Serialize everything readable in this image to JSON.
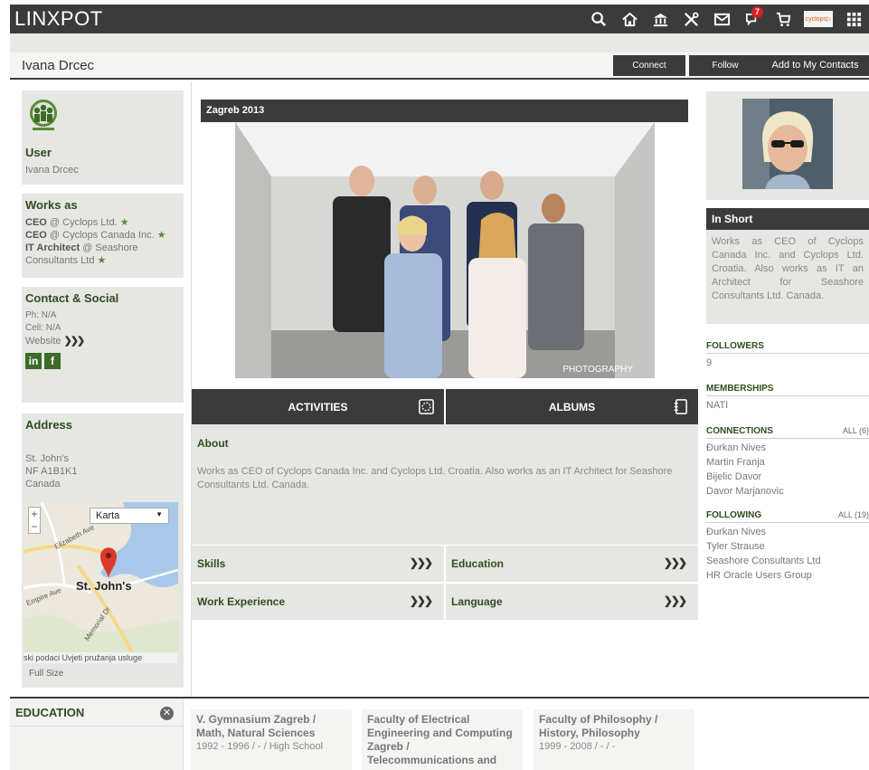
{
  "app": {
    "logo": "LINXPOT",
    "notification_count": "7",
    "cyclops_chip": "cyclops▷"
  },
  "profile": {
    "name": "Ivana Drcec",
    "connect_label": "Connect",
    "follow_label": "Follow",
    "add_contacts_label": "Add to My Contacts"
  },
  "left": {
    "user_heading": "User",
    "user_name": "Ivana Drcec",
    "works_heading": "Works as",
    "jobs": [
      {
        "role": "CEO",
        "at": "@ Cyclops Ltd."
      },
      {
        "role": "CEO",
        "at": "@ Cyclops Canada Inc."
      },
      {
        "role": "IT Architect",
        "at": "@ Seashore Consultants Ltd"
      }
    ],
    "contact_heading": "Contact & Social",
    "phone": "Ph: N/A",
    "cell": "Cell: N/A",
    "website": "Website",
    "website_arrows": "❯❯❯",
    "linkedin": "in",
    "facebook": "f",
    "address_heading": "Address",
    "address_lines": [
      "St. John's",
      "NF A1B1K1",
      "Canada"
    ],
    "map": {
      "type_select": "Karta",
      "city_label": "St. John's",
      "street1": "Elizabeth Ave",
      "street2": "Empire Ave",
      "street3": "Memorial Dr",
      "caption": "ski podaci  Uvjeti pružanja usluge",
      "full_size": "Full Size"
    }
  },
  "center": {
    "photo_title": "Zagreb 2013",
    "photo_watermark": "PHOTOGRAPHY",
    "tab_activities": "ACTIVITIES",
    "tab_albums": "ALBUMS",
    "about_heading": "About",
    "about_text": "Works as CEO of Cyclops Canada Inc. and Cyclops Ltd. Croatia. Also works as an IT Architect for Seashore Consultants Ltd. Canada.",
    "sections": [
      "Skills",
      "Education",
      "Work Experience",
      "Language"
    ],
    "arrows": "❯❯❯"
  },
  "right": {
    "inshort_heading": "In Short",
    "inshort_text": "Works as CEO of Cyclops Canada Inc. and Cyclops Ltd. Croatia. Also works as IT an Architect for Seashore Consultants Ltd. Canada.",
    "followers_heading": "FOLLOWERS",
    "followers_count": "9",
    "memberships_heading": "MEMBERSHIPS",
    "membership": "NATI",
    "connections_heading": "CONNECTIONS",
    "connections_all": "ALL (6)",
    "connections": [
      "Đurkan Nives",
      "Martin Franja",
      "Bijelic Davor",
      "Davor Marjanovic"
    ],
    "following_heading": "FOLLOWING",
    "following_all": "ALL (19)",
    "following": [
      "Đurkan Nives",
      "Tyler Strause",
      "Seashore Consultants Ltd",
      "HR Oracle Users Group"
    ]
  },
  "education": {
    "heading": "EDUCATION",
    "close": "✕",
    "cards": [
      {
        "school": "V. Gymnasium Zagreb / Math, Natural Sciences",
        "dates": "1992 - 1996 / - / High School"
      },
      {
        "school": "Faculty of Electrical Engineering and Computing Zagreb / Telecommunications and",
        "dates": ""
      },
      {
        "school": "Faculty of Philosophy / History, Philosophy",
        "dates": "1999 - 2008 / - / -"
      }
    ]
  }
}
